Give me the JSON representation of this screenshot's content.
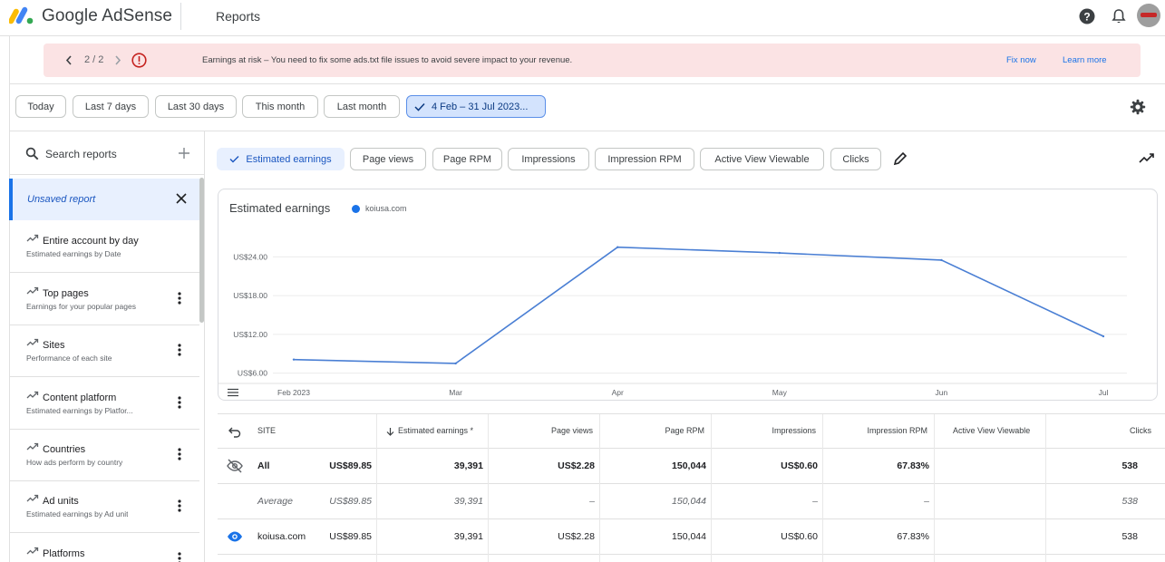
{
  "header": {
    "brand": "Google AdSense",
    "page_title": "Reports"
  },
  "banner": {
    "counter": "2 / 2",
    "message": "Earnings at risk – You need to fix some ads.txt file issues to avoid severe impact to your revenue.",
    "fix_now": "Fix now",
    "learn_more": "Learn more"
  },
  "date_filters": [
    "Today",
    "Last 7 days",
    "Last 30 days",
    "This month",
    "Last month"
  ],
  "date_range": "4 Feb – 31 Jul 2023...",
  "sidebar": {
    "search_placeholder": "Search reports",
    "unsaved": "Unsaved report",
    "reports": [
      {
        "title": "Entire account by day",
        "subtitle": "Estimated earnings by Date"
      },
      {
        "title": "Top pages",
        "subtitle": "Earnings for your popular pages"
      },
      {
        "title": "Sites",
        "subtitle": "Performance of each site"
      },
      {
        "title": "Content platform",
        "subtitle": "Estimated earnings by Platfor..."
      },
      {
        "title": "Countries",
        "subtitle": "How ads perform by country"
      },
      {
        "title": "Ad units",
        "subtitle": "Estimated earnings by Ad unit"
      },
      {
        "title": "Platforms",
        "subtitle": ""
      }
    ]
  },
  "metrics": [
    "Estimated earnings",
    "Page views",
    "Page RPM",
    "Impressions",
    "Impression RPM",
    "Active View Viewable",
    "Clicks"
  ],
  "chart_data": {
    "type": "line",
    "title": "Estimated earnings",
    "x": [
      "Feb 2023",
      "Mar",
      "Apr",
      "May",
      "Jun",
      "Jul"
    ],
    "y_ticks": [
      "US$6.00",
      "US$12.00",
      "US$18.00",
      "US$24.00"
    ],
    "ylim": [
      3,
      27
    ],
    "series": [
      {
        "name": "koiusa.com",
        "color": "#4a7fd4",
        "values": [
          8.1,
          7.5,
          25.5,
          24.6,
          23.5,
          11.7
        ]
      }
    ],
    "grid": true
  },
  "table": {
    "headers": [
      "SITE",
      "Estimated earnings *",
      "Page views",
      "Page RPM",
      "Impressions",
      "Impression RPM",
      "Active View Viewable",
      "Clicks"
    ],
    "rows": [
      {
        "site": "All",
        "earnings": "US$89.85",
        "page_views": "39,391",
        "page_rpm": "US$2.28",
        "impressions": "150,044",
        "impression_rpm": "US$0.60",
        "viewable": "67.83%",
        "clicks": "538"
      },
      {
        "site": "Average",
        "earnings": "US$89.85",
        "page_views": "39,391",
        "page_rpm": "–",
        "impressions": "150,044",
        "impression_rpm": "–",
        "viewable": "–",
        "clicks": "538"
      },
      {
        "site": "koiusa.com",
        "earnings": "US$89.85",
        "page_views": "39,391",
        "page_rpm": "US$2.28",
        "impressions": "150,044",
        "impression_rpm": "US$0.60",
        "viewable": "67.83%",
        "clicks": "538"
      }
    ]
  }
}
